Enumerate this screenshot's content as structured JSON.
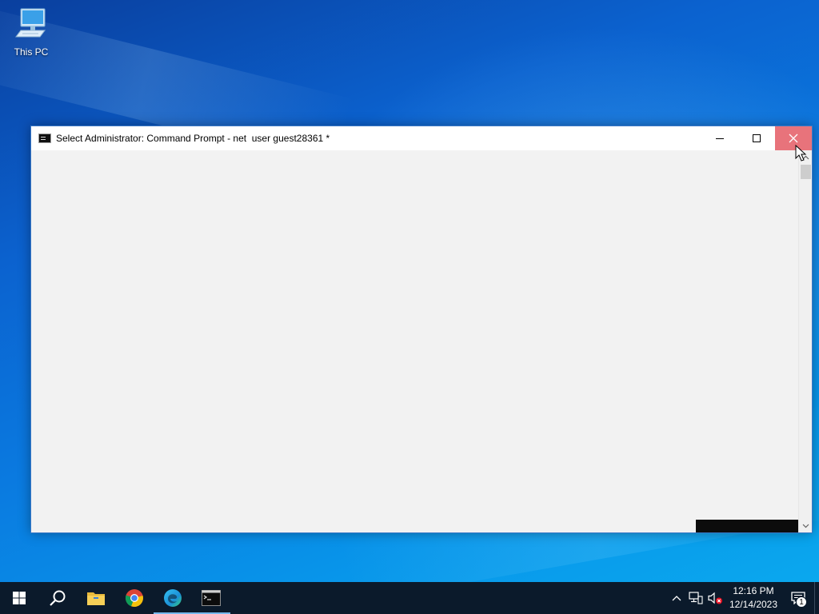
{
  "desktop": {
    "icons": [
      {
        "label": "This PC",
        "icon": "computer-icon"
      }
    ]
  },
  "window": {
    "title": "Select Administrator: Command Prompt - net  user guest28361 *",
    "icon": "console-icon",
    "controls": {
      "minimize": "minimize-icon",
      "maximize": "maximize-icon",
      "close": "close-icon"
    },
    "close_hover_color": "#e8737b"
  },
  "taskbar": {
    "start": "windows-logo-icon",
    "search": "search-icon",
    "apps": [
      {
        "name": "File Explorer",
        "icon": "folder-icon",
        "active": false
      },
      {
        "name": "Google Chrome",
        "icon": "chrome-icon",
        "active": false
      },
      {
        "name": "Microsoft Edge",
        "icon": "edge-icon",
        "active": true
      },
      {
        "name": "Command Prompt",
        "icon": "cmd-icon",
        "active": true
      }
    ],
    "tray": {
      "icons": [
        "chevron-up-icon",
        "network-icon",
        "volume-muted-icon"
      ],
      "time": "12:16 PM",
      "date": "12/14/2023",
      "notification_count": "1"
    }
  }
}
